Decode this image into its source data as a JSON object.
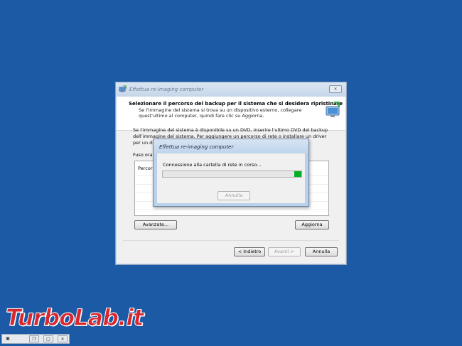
{
  "wizard": {
    "title": "Effettua re-imaging computer",
    "close_glyph": "✕",
    "header_title": "Selezionare il percorso del backup per il sistema che si desidera ripristinare",
    "header_sub": "Se l'immagine del sistema si trova su un dispositivo esterno, collegare quest'ultimo al computer, quindi fare clic su Aggiorna.",
    "body_text": "Se l'immagine del sistema è disponibile su un DVD, inserire l'ultimo DVD del backup dell'immagine del sistema. Per aggiungere un percorso di rete o installare un driver per un dispositiv",
    "fuso_label": "Fuso ora",
    "list_col": "Percors",
    "advanced_label": "Avanzate...",
    "refresh_label": "Aggiorna",
    "back_label": "< Indietro",
    "next_label": "Avanti >",
    "cancel_label": "Annulla"
  },
  "dialog": {
    "title": "Effettua re-imaging computer",
    "message": "Connessione alla cartella di rete in corso...",
    "progress": 0.05,
    "cancel_label": "Annulla"
  },
  "watermark": {
    "text": "TurboLab.it"
  },
  "icons": {
    "wizard": "system-restore-icon",
    "header": "computer-monitor-icon"
  }
}
